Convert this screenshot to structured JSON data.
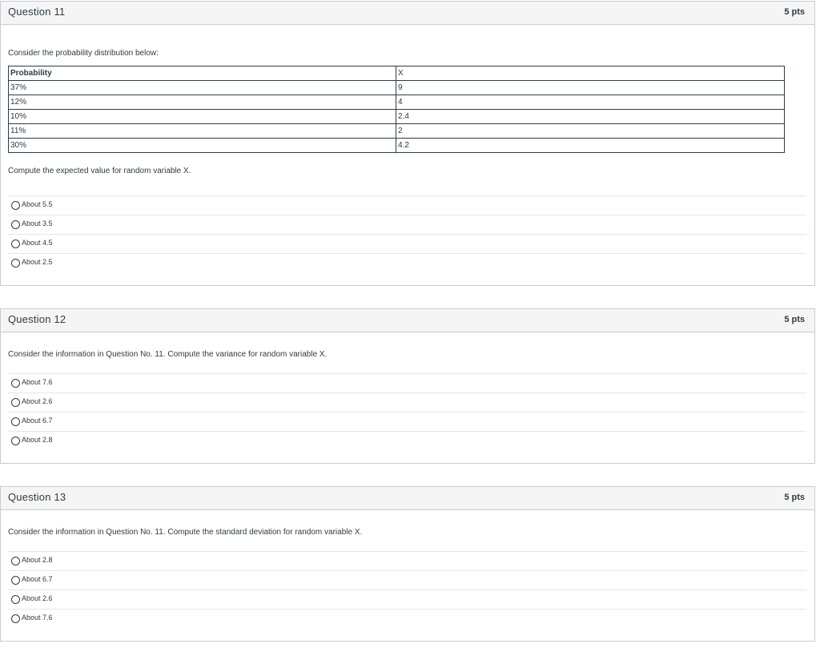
{
  "questions": [
    {
      "title": "Question 11",
      "points": "5 pts",
      "intro": "Consider the probability distribution below:",
      "table": {
        "headers": [
          "Probability",
          "X"
        ],
        "rows": [
          [
            "37%",
            "9"
          ],
          [
            "12%",
            "4"
          ],
          [
            "10%",
            "2.4"
          ],
          [
            "11%",
            "2"
          ],
          [
            "30%",
            "4.2"
          ]
        ]
      },
      "prompt": "Compute the expected value for random variable X.",
      "answers": [
        "About 5.5",
        "About 3.5",
        "About 4.5",
        "About 2.5"
      ]
    },
    {
      "title": "Question 12",
      "points": "5 pts",
      "prompt": "Consider the information in Question No. 11. Compute the variance for random variable X.",
      "answers": [
        "About 7.6",
        "About 2.6",
        "About 6.7",
        "About 2.8"
      ]
    },
    {
      "title": "Question 13",
      "points": "5 pts",
      "prompt": "Consider the information in Question No. 11. Compute the standard deviation for random variable X.",
      "answers": [
        "About 2.8",
        "About 6.7",
        "About 2.6",
        "About 7.6"
      ]
    }
  ]
}
